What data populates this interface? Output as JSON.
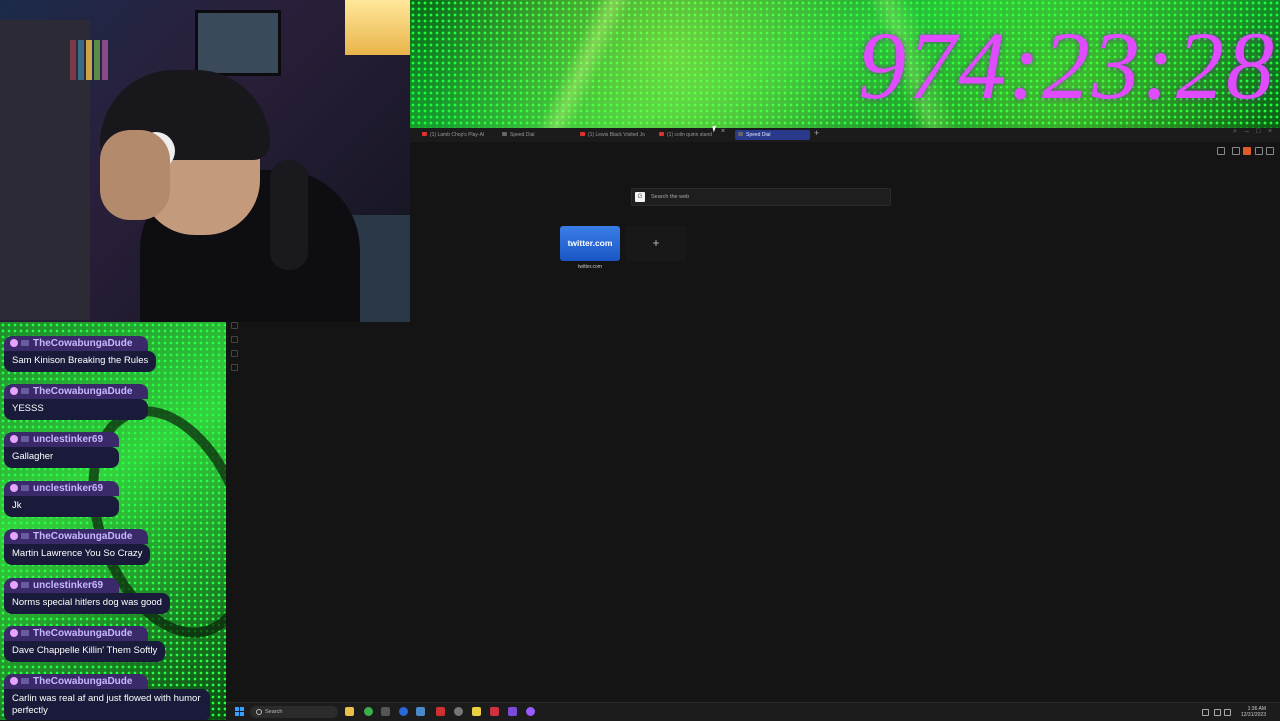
{
  "overlay": {
    "timer": "974:23:28"
  },
  "browser": {
    "tabs": [
      {
        "label": "(1) Lamb Chop's Play-Al",
        "favicon": "youtube-icon",
        "active": false
      },
      {
        "label": "Speed Dial",
        "favicon": "speed-dial-icon",
        "active": false
      },
      {
        "label": "(1) Lewis Black Visited Jo",
        "favicon": "youtube-icon",
        "active": false
      },
      {
        "label": "(1) colin quinn stand",
        "favicon": "youtube-icon",
        "active": false
      },
      {
        "label": "Speed Dial",
        "favicon": "speed-dial-icon",
        "active": true
      }
    ],
    "search_placeholder": "Search the web",
    "search_engine_icon": "G",
    "speed_dial": [
      {
        "title": "twitter.com",
        "caption": "twitter.com"
      }
    ],
    "add_tile_symbol": "+",
    "new_tab_symbol": "+",
    "close_symbol": "×"
  },
  "chat": {
    "messages": [
      {
        "user": "TheCowabungaDude",
        "text": "Sam Kinison Breaking the Rules"
      },
      {
        "user": "TheCowabungaDude",
        "text": "YESSS"
      },
      {
        "user": "unclestinker69",
        "text": "Gallagher"
      },
      {
        "user": "unclestinker69",
        "text": "Jk"
      },
      {
        "user": "TheCowabungaDude",
        "text": "Martin Lawrence You So Crazy"
      },
      {
        "user": "unclestinker69",
        "text": "Norms special hitlers dog was good"
      },
      {
        "user": "TheCowabungaDude",
        "text": "Dave Chappelle Killin' Them Softly"
      },
      {
        "user": "TheCowabungaDude",
        "text": "Carlin was real af and just flowed with humor perfectly"
      }
    ]
  },
  "taskbar": {
    "search_label": "Search",
    "time": "1:36 AM",
    "date": "12/31/2023"
  },
  "colors": {
    "timer": "#e04bff",
    "tab_active": "#2a3a8a",
    "chat_bubble": "#1a1a3a",
    "chat_username_bg": "#3a2a6a"
  }
}
